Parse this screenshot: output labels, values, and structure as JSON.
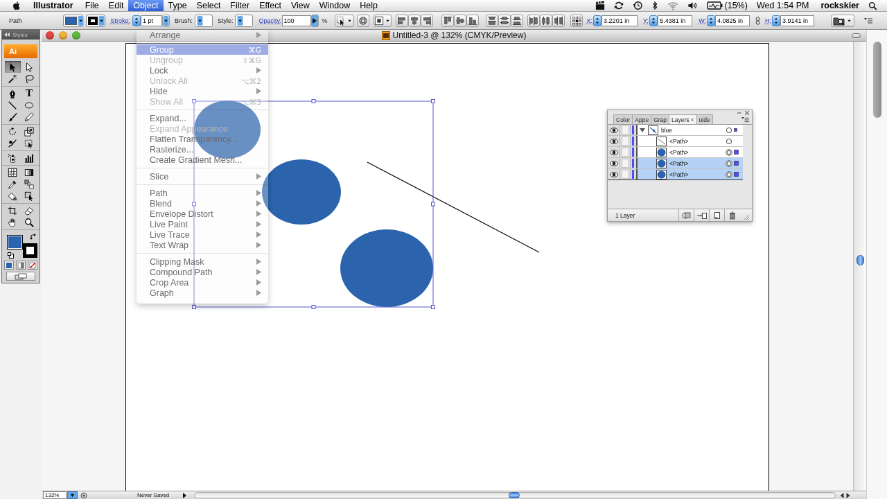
{
  "menu_bar": {
    "app_name": "Illustrator",
    "menus": [
      {
        "label": "File",
        "selected": false
      },
      {
        "label": "Edit",
        "selected": false
      },
      {
        "label": "Object",
        "selected": true
      },
      {
        "label": "Type",
        "selected": false
      },
      {
        "label": "Select",
        "selected": false
      },
      {
        "label": "Filter",
        "selected": false
      },
      {
        "label": "Effect",
        "selected": false
      },
      {
        "label": "View",
        "selected": false
      },
      {
        "label": "Window",
        "selected": false
      },
      {
        "label": "Help",
        "selected": false
      }
    ],
    "battery_percent": "(15%)",
    "clock": "Wed 1:54 PM",
    "user": "rockskier"
  },
  "control_bar": {
    "selection_type": "Path",
    "stroke_label": "Stroke:",
    "stroke_weight": "1 pt",
    "brush_label": "Brush:",
    "style_label": "Style:",
    "opacity_label": "Opacity:",
    "opacity": "100",
    "opacity_unit": "%",
    "transform_fields": [
      {
        "label": "X:",
        "value": "3.2201 in"
      },
      {
        "label": "Y:",
        "value": "5.4381 in"
      },
      {
        "label": "W:",
        "value": "4.0825 in"
      },
      {
        "label": "H:",
        "value": "3.9141 in"
      }
    ]
  },
  "tools_panel": {
    "hidden_tab": "Styles",
    "logo": "Ai",
    "tool_groups": [
      {
        "tools": [
          {
            "selected": true
          },
          {
            "selected": false
          },
          {
            "selected": false
          },
          {
            "selected": false
          }
        ]
      },
      {
        "tools": [
          {
            "selected": false
          },
          {
            "selected": false,
            "glyph": "T"
          },
          {
            "selected": false
          },
          {
            "selected": false
          },
          {
            "selected": false
          },
          {
            "selected": false
          }
        ]
      },
      {
        "tools": [
          {
            "selected": false
          },
          {
            "selected": false
          },
          {
            "selected": false
          },
          {
            "selected": false
          }
        ]
      },
      {
        "tools": [
          {
            "selected": false
          },
          {
            "selected": false
          }
        ]
      },
      {
        "tools": [
          {
            "selected": false
          },
          {
            "selected": false
          },
          {
            "selected": false
          },
          {
            "selected": false
          },
          {
            "selected": false
          },
          {
            "selected": false
          }
        ]
      },
      {
        "tools": [
          {
            "selected": false
          },
          {
            "selected": false
          },
          {
            "selected": false
          },
          {
            "selected": false
          }
        ]
      }
    ]
  },
  "document": {
    "title": "Untitled-3 @ 132% (CMYK/Preview)",
    "zoom": "132%",
    "status": "Never Saved"
  },
  "object_menu": {
    "sections": [
      {
        "items": [
          {
            "label": "Arrange",
            "submenu": true,
            "disabled": false,
            "selected": false
          }
        ]
      },
      {
        "items": [
          {
            "label": "Group",
            "shortcut": "⌘G",
            "submenu": false,
            "disabled": false,
            "selected": true
          },
          {
            "label": "Ungroup",
            "shortcut": "⇧⌘G",
            "submenu": false,
            "disabled": true,
            "selected": false
          },
          {
            "label": "Lock",
            "submenu": true,
            "disabled": false,
            "selected": false
          },
          {
            "label": "Unlock All",
            "shortcut": "⌥⌘2",
            "submenu": false,
            "disabled": true,
            "selected": false
          },
          {
            "label": "Hide",
            "submenu": true,
            "disabled": false,
            "selected": false
          },
          {
            "label": "Show All",
            "shortcut": "⌥⌘3",
            "submenu": false,
            "disabled": true,
            "selected": false
          }
        ]
      },
      {
        "items": [
          {
            "label": "Expand...",
            "submenu": false,
            "disabled": false,
            "selected": false
          },
          {
            "label": "Expand Appearance",
            "submenu": false,
            "disabled": true,
            "selected": false
          },
          {
            "label": "Flatten Transparency...",
            "submenu": false,
            "disabled": false,
            "selected": false
          },
          {
            "label": "Rasterize...",
            "submenu": false,
            "disabled": false,
            "selected": false
          },
          {
            "label": "Create Gradient Mesh...",
            "submenu": false,
            "disabled": false,
            "selected": false
          }
        ]
      },
      {
        "items": [
          {
            "label": "Slice",
            "submenu": true,
            "disabled": false,
            "selected": false
          }
        ]
      },
      {
        "items": [
          {
            "label": "Path",
            "submenu": true,
            "disabled": false,
            "selected": false
          },
          {
            "label": "Blend",
            "submenu": true,
            "disabled": false,
            "selected": false
          },
          {
            "label": "Envelope Distort",
            "submenu": true,
            "disabled": false,
            "selected": false
          },
          {
            "label": "Live Paint",
            "submenu": true,
            "disabled": false,
            "selected": false
          },
          {
            "label": "Live Trace",
            "submenu": true,
            "disabled": false,
            "selected": false
          },
          {
            "label": "Text Wrap",
            "submenu": true,
            "disabled": false,
            "selected": false
          }
        ]
      },
      {
        "items": [
          {
            "label": "Clipping Mask",
            "submenu": true,
            "disabled": false,
            "selected": false
          },
          {
            "label": "Compound Path",
            "submenu": true,
            "disabled": false,
            "selected": false
          },
          {
            "label": "Crop Area",
            "submenu": true,
            "disabled": false,
            "selected": false
          },
          {
            "label": "Graph",
            "submenu": true,
            "disabled": false,
            "selected": false
          }
        ]
      }
    ]
  },
  "layers_panel": {
    "tabs": [
      {
        "label": "Color",
        "selected": false
      },
      {
        "label": "Appe",
        "selected": false
      },
      {
        "label": "Grap",
        "selected": false
      },
      {
        "label": "Layers",
        "selected": true,
        "close": "×"
      },
      {
        "label": "uide",
        "selected": false
      }
    ],
    "layers": [
      {
        "name": "blue",
        "visible": true,
        "expanded": true,
        "selected": false,
        "art_selected": true,
        "children": [
          {
            "name": "<Path>",
            "kind": "line",
            "visible": true,
            "selected": false,
            "art_selected": false
          },
          {
            "name": "<Path>",
            "kind": "ellipse",
            "visible": true,
            "selected": false,
            "art_selected": true
          },
          {
            "name": "<Path>",
            "kind": "ellipse",
            "visible": true,
            "selected": true,
            "art_selected": true
          },
          {
            "name": "<Path>",
            "kind": "ellipse",
            "visible": true,
            "selected": true,
            "art_selected": true
          }
        ]
      }
    ],
    "footer": "1 Layer"
  }
}
